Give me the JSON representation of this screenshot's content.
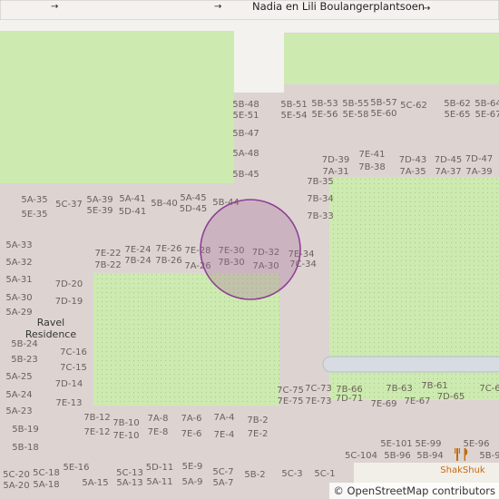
{
  "map": {
    "street_name": "Nadia en Lili Boulangerplantsoen",
    "street_arrows": [
      "→",
      "→",
      "→"
    ],
    "place_label": [
      "Ravel",
      "Residence"
    ],
    "poi": {
      "name": "ShakShuk",
      "icon": "restaurant-icon"
    },
    "attribution": "© OpenStreetMap contributors",
    "colors": {
      "background": "#ddd4d2",
      "park": "#cdebb0",
      "road": "#f4f2ee",
      "road_outline": "#c9bfbd",
      "path": "#d7dbe2",
      "marker_fill": "#a86c9c",
      "marker_stroke": "#8e3f95",
      "label": "#6b5f5a",
      "poi": "#c46b10"
    },
    "address_labels": [
      "5B-48",
      "5E-51",
      "5B-51",
      "5E-54",
      "5B-53",
      "5E-56",
      "5B-55",
      "5E-58",
      "5B-57",
      "5E-60",
      "5C-62",
      "5B-62",
      "5E-65",
      "5B-64",
      "5E-67",
      "5B-47",
      "5A-48",
      "5B-45",
      "7D-39",
      "7A-31",
      "7E-41",
      "7B-38",
      "7D-43",
      "7A-35",
      "7D-45",
      "7A-37",
      "7D-47",
      "7A-39",
      "7B-35",
      "7B-34",
      "7B-33",
      "5A-35",
      "5E-35",
      "5C-37",
      "5A-39",
      "5E-39",
      "5A-41",
      "5D-41",
      "5B-40",
      "5A-45",
      "5D-45",
      "5B-44",
      "5A-33",
      "5A-32",
      "5A-31",
      "5A-30",
      "5A-29",
      "5B-24",
      "5B-23",
      "5A-25",
      "5A-24",
      "5A-23",
      "5B-19",
      "5B-18",
      "5C-20",
      "5A-20",
      "7E-22",
      "7B-22",
      "7E-24",
      "7B-24",
      "7E-26",
      "7B-26",
      "7E-28",
      "7A-26",
      "7E-30",
      "7B-30",
      "7D-32",
      "7A-30",
      "7E-34",
      "7C-34",
      "7D-20",
      "7D-19",
      "7C-16",
      "7C-15",
      "7D-14",
      "7E-13",
      "7B-12",
      "7E-12",
      "7B-10",
      "7E-10",
      "7A-8",
      "7E-8",
      "7A-6",
      "7E-6",
      "7A-4",
      "7E-4",
      "7B-2",
      "7E-2",
      "7C-75",
      "7E-75",
      "7C-73",
      "7E-73",
      "7B-66",
      "7D-71",
      "7E-69",
      "7B-63",
      "7E-67",
      "7B-61",
      "7D-65",
      "7C-6",
      "5E-16",
      "5C-18",
      "5A-18",
      "5A-15",
      "5C-13",
      "5A-13",
      "5D-11",
      "5A-11",
      "5E-9",
      "5A-9",
      "5C-7",
      "5A-7",
      "5B-2",
      "5C-3",
      "5C-1",
      "5E-101",
      "5C-104",
      "5E-99",
      "5B-96",
      "5B-94",
      "5E-96",
      "5B-9"
    ]
  }
}
